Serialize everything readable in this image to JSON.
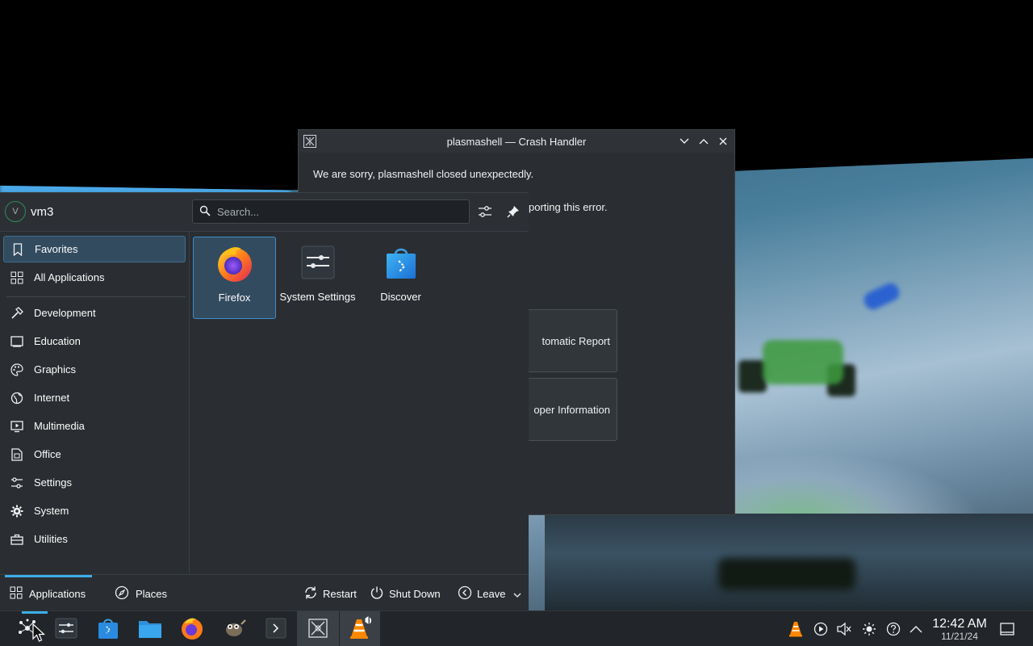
{
  "crash_handler": {
    "title": "plasmashell — Crash Handler",
    "message": "We are sorry, plasmashell closed unexpectedly.",
    "partial_message": "porting this error.",
    "button_report": "tomatic Report",
    "button_developer": "oper Information"
  },
  "launcher": {
    "username": "vm3",
    "avatar_letter": "V",
    "search_placeholder": "Search...",
    "sidebar": {
      "favorites": "Favorites",
      "all_applications": "All Applications",
      "categories": [
        "Development",
        "Education",
        "Graphics",
        "Internet",
        "Multimedia",
        "Office",
        "Settings",
        "System",
        "Utilities"
      ]
    },
    "favorites": [
      {
        "name": "Firefox",
        "icon": "firefox-icon"
      },
      {
        "name": "System Settings",
        "icon": "system-settings-icon"
      },
      {
        "name": "Discover",
        "icon": "discover-icon"
      }
    ],
    "footer": {
      "applications": "Applications",
      "places": "Places",
      "restart": "Restart",
      "shut_down": "Shut Down",
      "leave": "Leave"
    }
  },
  "taskbar": {
    "items": [
      "application-launcher-icon",
      "system-settings-icon",
      "discover-icon",
      "file-manager-icon",
      "firefox-icon",
      "gimp-icon",
      "terminal-icon",
      "crash-handler-icon",
      "vlc-icon"
    ],
    "tray": [
      "vlc-tray-icon",
      "media-player-icon",
      "volume-muted-icon",
      "brightness-icon",
      "help-icon",
      "expand-tray-icon"
    ],
    "clock_time": "12:42 AM",
    "clock_date": "11/21/24"
  },
  "colors": {
    "accent": "#3daee9",
    "panel_bg": "#2a2e32",
    "taskbar_bg": "#22262a"
  }
}
